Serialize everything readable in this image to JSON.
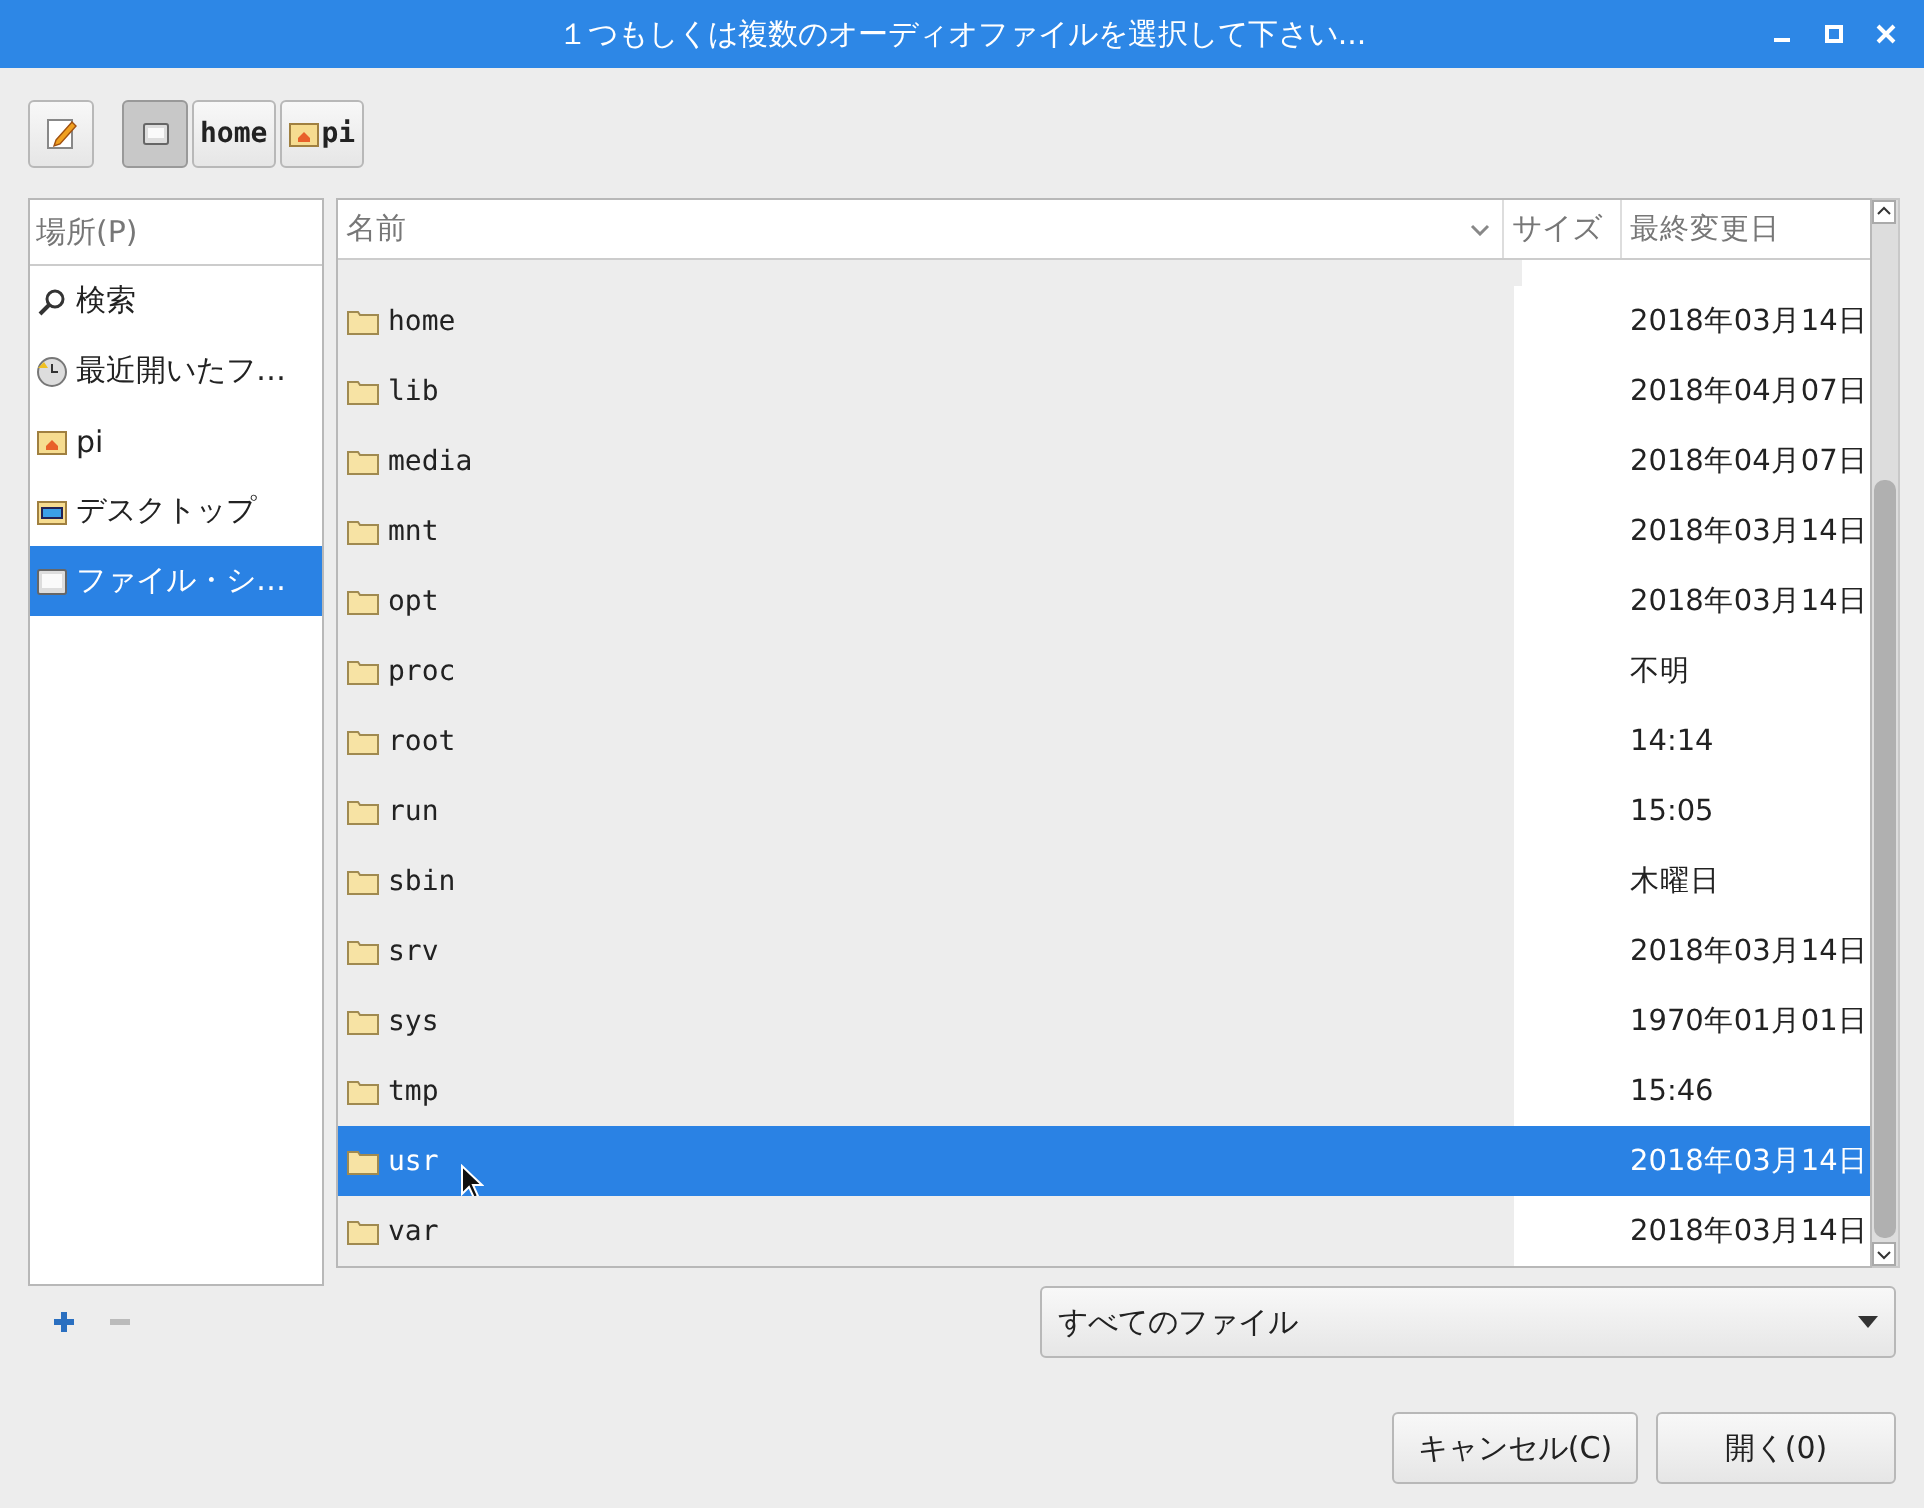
{
  "window": {
    "title": "１つもしくは複数のオーディオファイルを選択して下さい..."
  },
  "path_bar": [
    {
      "kind": "root",
      "selected": true
    },
    {
      "kind": "folder",
      "label": "home",
      "selected": false
    },
    {
      "kind": "home",
      "label": "pi",
      "selected": false
    }
  ],
  "places": {
    "header": "場所(P)",
    "items": [
      {
        "kind": "search",
        "label": "検索",
        "selected": false
      },
      {
        "kind": "recent",
        "label": "最近開いたフ…",
        "selected": false
      },
      {
        "kind": "home",
        "label": "pi",
        "selected": false
      },
      {
        "kind": "desktop",
        "label": "デスクトップ",
        "selected": false
      },
      {
        "kind": "drive",
        "label": "ファイル・シ…",
        "selected": true
      }
    ]
  },
  "files": {
    "columns": [
      "名前",
      "サイズ",
      "最終変更日"
    ],
    "rows": [
      {
        "name": "home",
        "modified": "2018年03月14日",
        "selected": false
      },
      {
        "name": "lib",
        "modified": "2018年04月07日",
        "selected": false
      },
      {
        "name": "media",
        "modified": "2018年04月07日",
        "selected": false
      },
      {
        "name": "mnt",
        "modified": "2018年03月14日",
        "selected": false
      },
      {
        "name": "opt",
        "modified": "2018年03月14日",
        "selected": false
      },
      {
        "name": "proc",
        "modified": "不明",
        "selected": false
      },
      {
        "name": "root",
        "modified": "14:14",
        "selected": false
      },
      {
        "name": "run",
        "modified": "15:05",
        "selected": false
      },
      {
        "name": "sbin",
        "modified": "木曜日",
        "selected": false
      },
      {
        "name": "srv",
        "modified": "2018年03月14日",
        "selected": false
      },
      {
        "name": "sys",
        "modified": "1970年01月01日",
        "selected": false
      },
      {
        "name": "tmp",
        "modified": "15:46",
        "selected": false
      },
      {
        "name": "usr",
        "modified": "2018年03月14日",
        "selected": true
      },
      {
        "name": "var",
        "modified": "2018年03月14日",
        "selected": false
      }
    ]
  },
  "filter": {
    "value": "すべてのファイル"
  },
  "buttons": [
    {
      "kind": "cancel",
      "label": "キャンセル(C)"
    },
    {
      "kind": "open",
      "label": "開く(0)"
    }
  ]
}
